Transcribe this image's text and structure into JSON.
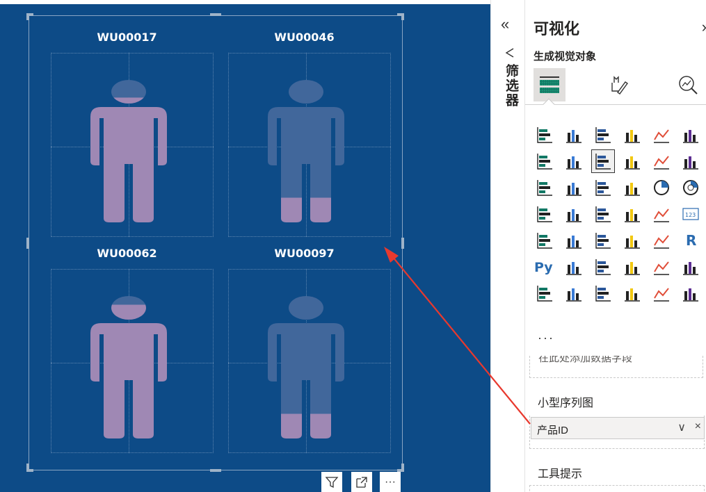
{
  "small_multiples": [
    {
      "title": "WU00017",
      "fill_fraction": 0.84
    },
    {
      "title": "WU00046",
      "fill_fraction": 0.17
    },
    {
      "title": "WU00062",
      "fill_fraction": 0.9
    },
    {
      "title": "WU00097",
      "fill_fraction": 0.17
    }
  ],
  "colors": {
    "canvas": "#0d4b87",
    "figure_fill": "#9f88b4",
    "figure_empty": "#41679b",
    "arrow": "#e8392e"
  },
  "visual_toolbar": {
    "filter_icon": "filter-icon",
    "focus_icon": "focus-mode-icon",
    "more_label": "···"
  },
  "filters_pane": {
    "collapse_label": "«",
    "label": "筛选器"
  },
  "viz_pane": {
    "title": "可视化",
    "expand_label": "»",
    "subtitle": "生成视觉对象",
    "tabs": [
      "build-visual-icon",
      "format-visual-icon",
      "analytics-icon"
    ],
    "gallery_icons": [
      "stacked-bar-chart-icon",
      "stacked-column-chart-icon",
      "clustered-bar-chart-icon",
      "clustered-column-chart-icon",
      "100-stacked-bar-chart-icon",
      "100-stacked-column-chart-icon",
      "line-chart-icon",
      "area-chart-icon",
      "stacked-area-chart-icon",
      "100-stacked-area-chart-icon",
      "line-and-stacked-column-chart-icon",
      "line-and-clustered-column-chart-icon",
      "ribbon-chart-icon",
      "waterfall-chart-icon",
      "funnel-chart-icon",
      "scatter-chart-icon",
      "pie-chart-icon",
      "donut-chart-icon",
      "treemap-icon",
      "map-icon",
      "filled-map-icon",
      "azure-map-icon",
      "gauge-icon",
      "card-icon",
      "multi-row-card-icon",
      "kpi-icon",
      "slicer-icon",
      "table-icon",
      "matrix-icon",
      "r-visual-icon",
      "python-visual-icon",
      "key-influencers-icon",
      "decomposition-tree-icon",
      "qna-icon",
      "smart-narrative-icon",
      "goals-icon",
      "paginated-report-icon",
      "power-automate-icon",
      "custom-visual-icon",
      "arcgis-map-icon",
      "power-apps-icon",
      "power-automate-flow-icon"
    ],
    "more_label": "···",
    "placeholder": "在此处添加数据字段",
    "small_multiples_label": "小型序列图",
    "field_name": "产品ID",
    "field_dropdown": "∨",
    "field_remove": "×",
    "tooltip_label": "工具提示"
  }
}
